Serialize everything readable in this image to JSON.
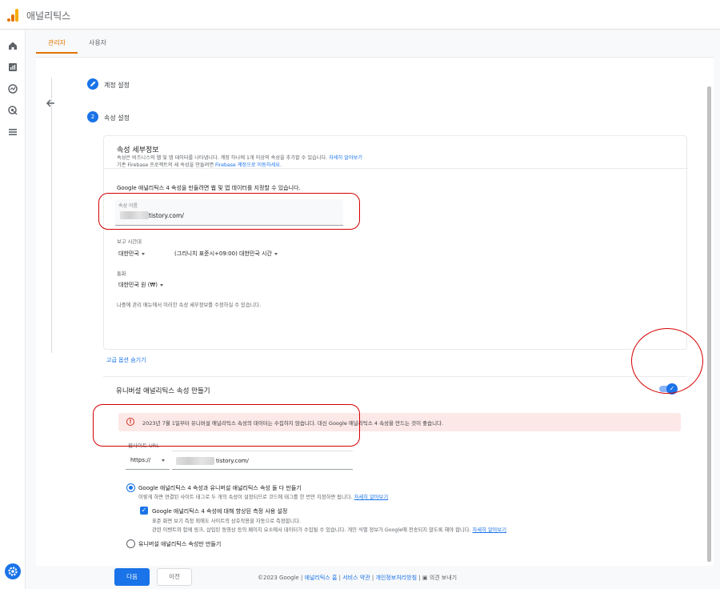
{
  "app": {
    "title": "애널리틱스"
  },
  "tabs": [
    {
      "label": "관리자",
      "active": true
    },
    {
      "label": "사용자",
      "active": false
    }
  ],
  "steps": [
    {
      "label": "계정 설정",
      "icon": "pencil-icon"
    },
    {
      "label": "속성 설정",
      "number": "2"
    }
  ],
  "property": {
    "title": "속성 세부정보",
    "desc_line1": "속성은 비즈니스의 웹 및 앱 데이터를 나타냅니다. 계정 하나에 1개 이상의 속성을 추가할 수 있습니다.",
    "desc_link1": "자세히 알아보기",
    "desc_line2_a": "기존 Firebase 프로젝트의 새 속성을 만들려면",
    "desc_link2": "Firebase 계정으로 이동하세요.",
    "ga4_label": "Google 애널리틱스 4 속성을 만들려면 웹 및 앱 데이터를 지정할 수 있습니다.",
    "name_label": "속성 이름",
    "name_value": "tistory.com/",
    "tz_label": "보고 시간대",
    "tz_country": "대한민국",
    "tz_value": "(그리니치 표준시+09:00) 대한민국 시간",
    "currency_label": "통화",
    "currency_value": "대한민국 원 (₩)",
    "note": "나중에 관리 메뉴에서 이러한 속성 세부정보를 수정하실 수 있습니다."
  },
  "advanced_link": "고급 옵션 숨기기",
  "ua": {
    "title": "유니버설 애널리틱스 속성 만들기",
    "toggle_on": true
  },
  "alert": {
    "text": "2023년 7월 1일부터 유니버설 애널리틱스 속성의 데이터는 수집하지 않습니다. 대신 Google 애널리틱스 4 속성을 만드는 것이 좋습니다."
  },
  "url": {
    "label": "웹사이트 URL",
    "protocol": "https://",
    "value": "tistory.com/"
  },
  "options": {
    "both_title": "Google 애널리틱스 4 속성과 유니버설 애널리틱스 속성 둘 다 만들기",
    "both_desc": "이렇게 하면 연결된 사이트 태그로 두 개의 속성이 설정되므로 코드에 태그를 한 번만 지정하면 됩니다.",
    "both_link": "자세히 알아보기",
    "enhanced_title": "Google 애널리틱스 4 속성에 대해 향상된 측정 사용 설정",
    "enhanced_desc1": "표준 화면 보기 측정 외에도 사이트의 상호작용을 자동으로 측정합니다.",
    "enhanced_desc2": "관련 이벤트와 함께 링크, 삽입된 동영상 등의 페이지 요소에서 데이터가 수집될 수 있습니다. 개인 식별 정보가 Google에 전송되지 않도록 해야 합니다.",
    "enhanced_link": "자세히 알아보기",
    "ua_only_title": "유니버설 애널리틱스 속성만 만들기"
  },
  "buttons": {
    "next": "다음",
    "prev": "이전"
  },
  "footer": {
    "copyright": "©2023 Google",
    "links": [
      "애널리틱스 홈",
      "서비스 약관",
      "개인정보처리방침"
    ],
    "feedback": "의견 보내기"
  }
}
